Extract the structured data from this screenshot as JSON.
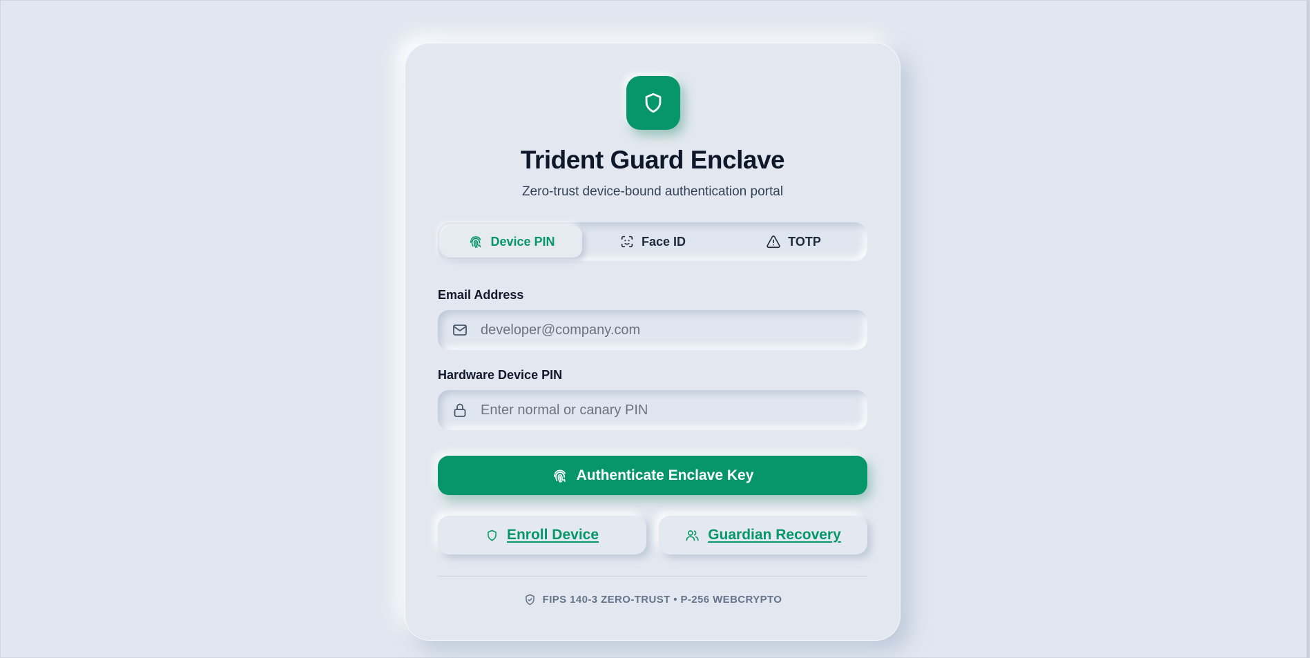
{
  "app": {
    "title": "Trident Guard Enclave",
    "subtitle": "Zero-trust device-bound authentication portal",
    "logo_icon": "shield-icon",
    "accent_color": "#07966a"
  },
  "tabs": [
    {
      "label": "Device PIN",
      "icon": "fingerprint-icon",
      "active": true
    },
    {
      "label": "Face ID",
      "icon": "face-scan-icon",
      "active": false
    },
    {
      "label": "TOTP",
      "icon": "warning-triangle-icon",
      "active": false
    }
  ],
  "form": {
    "email": {
      "label": "Email Address",
      "placeholder": "developer@company.com",
      "value": "",
      "icon": "mail-icon"
    },
    "pin": {
      "label": "Hardware Device PIN",
      "placeholder": "Enter normal or canary PIN",
      "value": "",
      "icon": "lock-icon"
    }
  },
  "actions": {
    "primary_label": "Authenticate Enclave Key",
    "enroll_label": "Enroll Device",
    "recovery_label": "Guardian Recovery"
  },
  "footer": {
    "text": "FIPS 140-3 ZERO-TRUST • P-256 WEBCRYPTO",
    "icon": "shield-check-icon"
  }
}
